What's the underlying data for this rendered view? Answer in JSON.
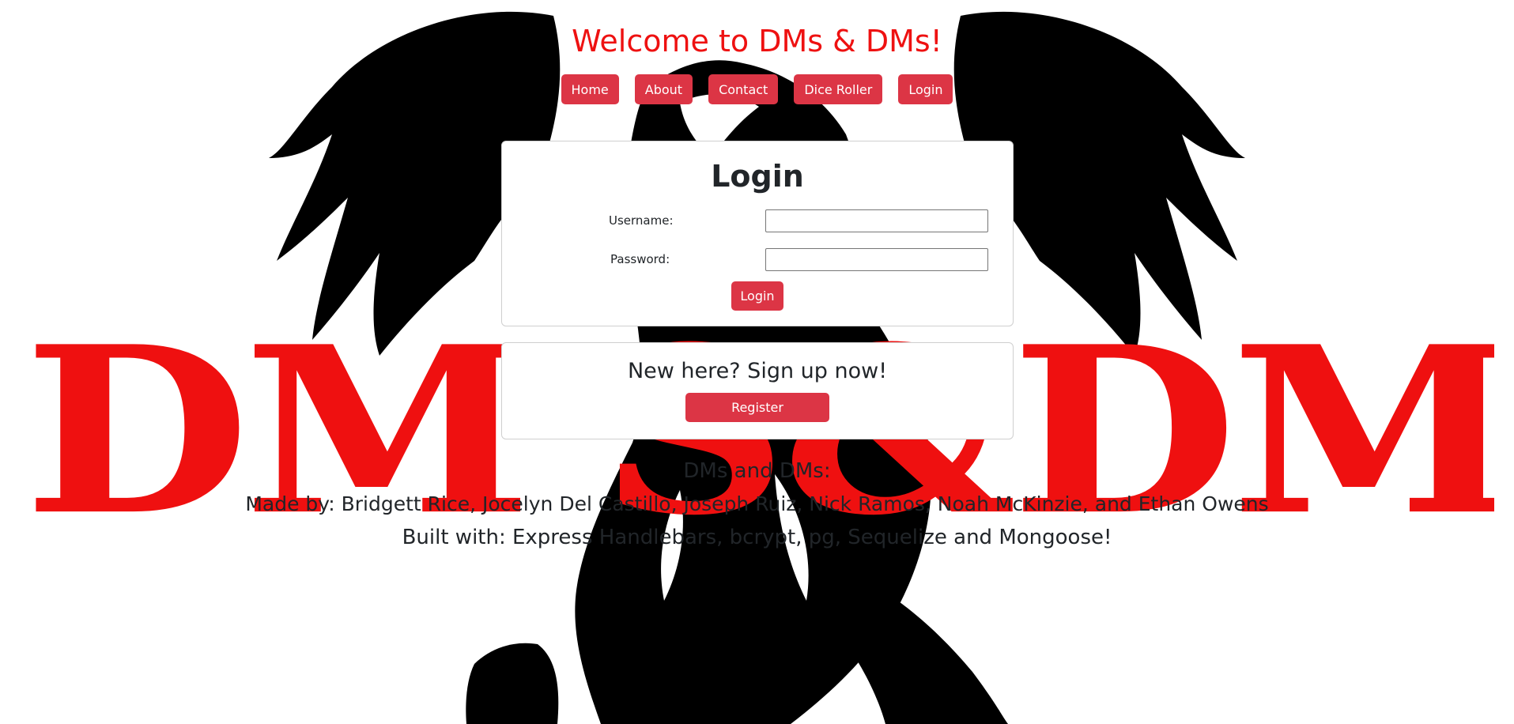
{
  "background": {
    "logo_left": "DM'S",
    "logo_middle": "&",
    "logo_right": "DM'S",
    "logo_color": "#ef1010",
    "art_color": "#000000"
  },
  "header": {
    "title": "Welcome to DMs & DMs!",
    "title_color": "#ee1111"
  },
  "nav": {
    "items": [
      "Home",
      "About",
      "Contact",
      "Dice Roller",
      "Login"
    ],
    "button_color": "#dc3545"
  },
  "login": {
    "heading": "Login",
    "username_label": "Username:",
    "username_value": "",
    "password_label": "Password:",
    "password_value": "",
    "submit_label": "Login"
  },
  "signup": {
    "heading": "New here? Sign up now!",
    "register_label": "Register"
  },
  "footer": {
    "title": "DMs and DMs:",
    "credits": "Made by: Bridgett Rice, Jocelyn Del Castillo, Joseph Ruiz, Nick Ramos, Noah McKinzie, and Ethan Owens",
    "built_with": "Built with: Express Handlebars, bcrypt, pg, Sequelize and Mongoose!"
  }
}
